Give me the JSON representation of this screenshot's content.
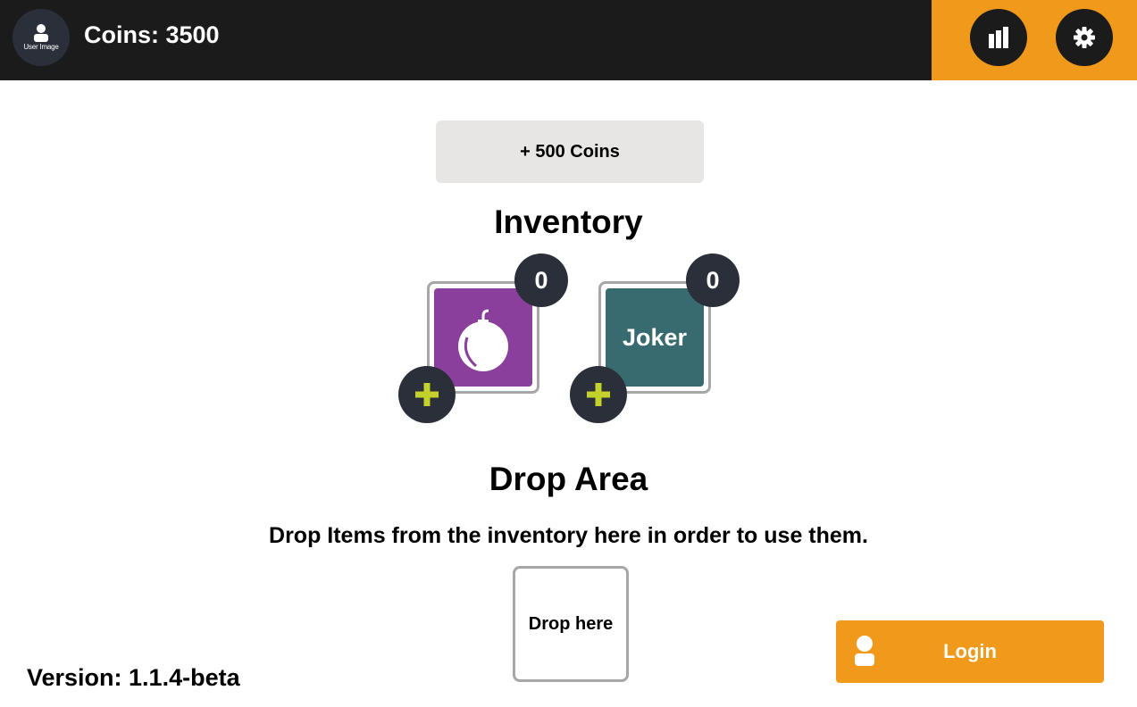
{
  "header": {
    "avatar_label": "User Image",
    "coins_text": "Coins: 3500",
    "leaderboard_icon": "bar-chart-icon",
    "settings_icon": "gear-icon"
  },
  "actions": {
    "add_coins_label": "+ 500 Coins"
  },
  "inventory": {
    "title": "Inventory",
    "items": [
      {
        "name": "bomb",
        "icon": "bomb-icon",
        "count": "0",
        "color": "#8a3f9d"
      },
      {
        "name": "joker",
        "label": "Joker",
        "count": "0",
        "color": "#386b70"
      }
    ]
  },
  "drop_area": {
    "title": "Drop Area",
    "instruction": "Drop Items from the inventory here in order to use them.",
    "placeholder": "Drop here"
  },
  "login": {
    "label": "Login",
    "icon": "user-icon"
  },
  "footer": {
    "version": "Version: 1.1.4-beta"
  },
  "colors": {
    "header_bg": "#1b1b1b",
    "accent": "#f0991b",
    "badge_bg": "#2a2f3a",
    "plus": "#c3d12a"
  }
}
